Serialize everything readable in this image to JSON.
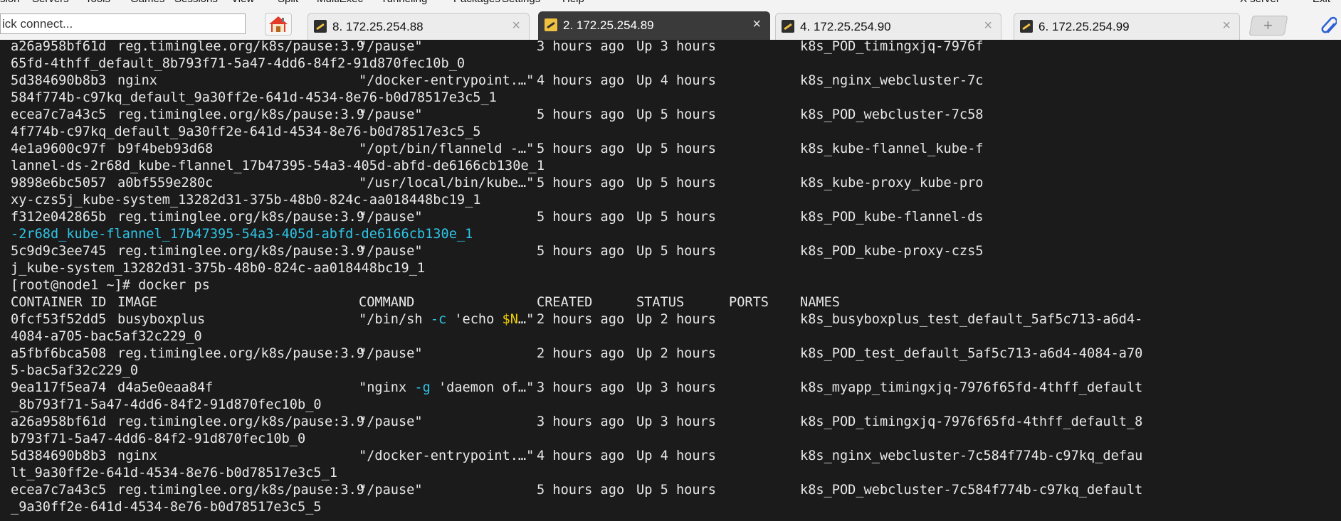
{
  "menu": [
    "sion",
    "Servers",
    "Tools",
    "Games",
    "Sessions",
    "View",
    "Split",
    "MultiExec",
    "Tunneling",
    "Packages",
    "Settings",
    "Help",
    "X server",
    "Exit"
  ],
  "toolbar": {
    "quick_connect_value": "ick connect...",
    "new_tab_symbol": "+"
  },
  "tabs": [
    {
      "label": "8. 172.25.254.88",
      "active": false
    },
    {
      "label": "2. 172.25.254.89",
      "active": true
    },
    {
      "label": "4. 172.25.254.90",
      "active": false
    },
    {
      "label": "6. 172.25.254.99",
      "active": false
    }
  ],
  "tab_close_symbol": "×",
  "terminal": {
    "lines": [
      {
        "cols": [
          "a26a958bf61d",
          "reg.timinglee.org/k8s/pause:3.9",
          "\"/pause\"",
          "3 hours ago",
          "Up 3 hours",
          "",
          "k8s_POD_timingxjq-7976f"
        ]
      },
      {
        "text": "65fd-4thff_default_8b793f71-5a47-4dd6-84f2-91d870fec10b_0"
      },
      {
        "cols": [
          "5d384690b8b3",
          "nginx",
          "\"/docker-entrypoint.…\"",
          "4 hours ago",
          "Up 4 hours",
          "",
          "k8s_nginx_webcluster-7c"
        ]
      },
      {
        "text": "584f774b-c97kq_default_9a30ff2e-641d-4534-8e76-b0d78517e3c5_1"
      },
      {
        "cols": [
          "ecea7c7a43c5",
          "reg.timinglee.org/k8s/pause:3.9",
          "\"/pause\"",
          "5 hours ago",
          "Up 5 hours",
          "",
          "k8s_POD_webcluster-7c58"
        ]
      },
      {
        "text": "4f774b-c97kq_default_9a30ff2e-641d-4534-8e76-b0d78517e3c5_5"
      },
      {
        "cols": [
          "4e1a9600c97f",
          "b9f4beb93d68",
          "\"/opt/bin/flanneld -…\"",
          "5 hours ago",
          "Up 5 hours",
          "",
          "k8s_kube-flannel_kube-f"
        ]
      },
      {
        "text": "lannel-ds-2r68d_kube-flannel_17b47395-54a3-405d-abfd-de6166cb130e_1"
      },
      {
        "cols": [
          "9898e6bc5057",
          "a0bf559e280c",
          "\"/usr/local/bin/kube…\"",
          "5 hours ago",
          "Up 5 hours",
          "",
          "k8s_kube-proxy_kube-pro"
        ]
      },
      {
        "text": "xy-czs5j_kube-system_13282d31-375b-48b0-824c-aa018448bc19_1"
      },
      {
        "cols": [
          "f312e042865b",
          "reg.timinglee.org/k8s/pause:3.9",
          "\"/pause\"",
          "5 hours ago",
          "Up 5 hours",
          "",
          "k8s_POD_kube-flannel-ds"
        ]
      },
      {
        "text": "-2r68d_kube-flannel_17b47395-54a3-405d-abfd-de6166cb130e_1",
        "color": "cyan"
      },
      {
        "cols": [
          "5c9d9c3ee745",
          "reg.timinglee.org/k8s/pause:3.9",
          "\"/pause\"",
          "5 hours ago",
          "Up 5 hours",
          "",
          "k8s_POD_kube-proxy-czs5"
        ]
      },
      {
        "text": "j_kube-system_13282d31-375b-48b0-824c-aa018448bc19_1"
      },
      {
        "text": "[root@node1 ~]# docker ps"
      },
      {
        "cols": [
          "CONTAINER ID",
          "IMAGE",
          "COMMAND",
          "CREATED",
          "STATUS",
          "PORTS",
          "NAMES"
        ]
      },
      {
        "cols": [
          "0fcf53f52dd5",
          "busyboxplus",
          "",
          "2 hours ago",
          "Up 2 hours",
          "",
          "k8s_busyboxplus_test_default_5af5c713-a6d4-"
        ],
        "cmd_parts": [
          [
            "\"/bin/sh ",
            ""
          ],
          [
            "-c",
            "cyan"
          ],
          [
            " 'echo ",
            ""
          ],
          [
            "$N",
            "yellow"
          ],
          [
            "…\"",
            ""
          ]
        ]
      },
      {
        "text": "4084-a705-bac5af32c229_0"
      },
      {
        "cols": [
          "a5fbf6bca508",
          "reg.timinglee.org/k8s/pause:3.9",
          "\"/pause\"",
          "2 hours ago",
          "Up 2 hours",
          "",
          "k8s_POD_test_default_5af5c713-a6d4-4084-a70"
        ]
      },
      {
        "text": "5-bac5af32c229_0"
      },
      {
        "cols": [
          "9ea117f5ea74",
          "d4a5e0eaa84f",
          "",
          "3 hours ago",
          "Up 3 hours",
          "",
          "k8s_myapp_timingxjq-7976f65fd-4thff_default"
        ],
        "cmd_parts": [
          [
            "\"nginx ",
            ""
          ],
          [
            "-g",
            "cyan"
          ],
          [
            " 'daemon of…\"",
            ""
          ]
        ]
      },
      {
        "text": "_8b793f71-5a47-4dd6-84f2-91d870fec10b_0"
      },
      {
        "cols": [
          "a26a958bf61d",
          "reg.timinglee.org/k8s/pause:3.9",
          "\"/pause\"",
          "3 hours ago",
          "Up 3 hours",
          "",
          "k8s_POD_timingxjq-7976f65fd-4thff_default_8"
        ]
      },
      {
        "text": "b793f71-5a47-4dd6-84f2-91d870fec10b_0"
      },
      {
        "cols": [
          "5d384690b8b3",
          "nginx",
          "\"/docker-entrypoint.…\"",
          "4 hours ago",
          "Up 4 hours",
          "",
          "k8s_nginx_webcluster-7c584f774b-c97kq_defau"
        ]
      },
      {
        "text": "lt_9a30ff2e-641d-4534-8e76-b0d78517e3c5_1"
      },
      {
        "cols": [
          "ecea7c7a43c5",
          "reg.timinglee.org/k8s/pause:3.9",
          "\"/pause\"",
          "5 hours ago",
          "Up 5 hours",
          "",
          "k8s_POD_webcluster-7c584f774b-c97kq_default"
        ]
      },
      {
        "text": "_9a30ff2e-641d-4534-8e76-b0d78517e3c5_5"
      }
    ]
  }
}
